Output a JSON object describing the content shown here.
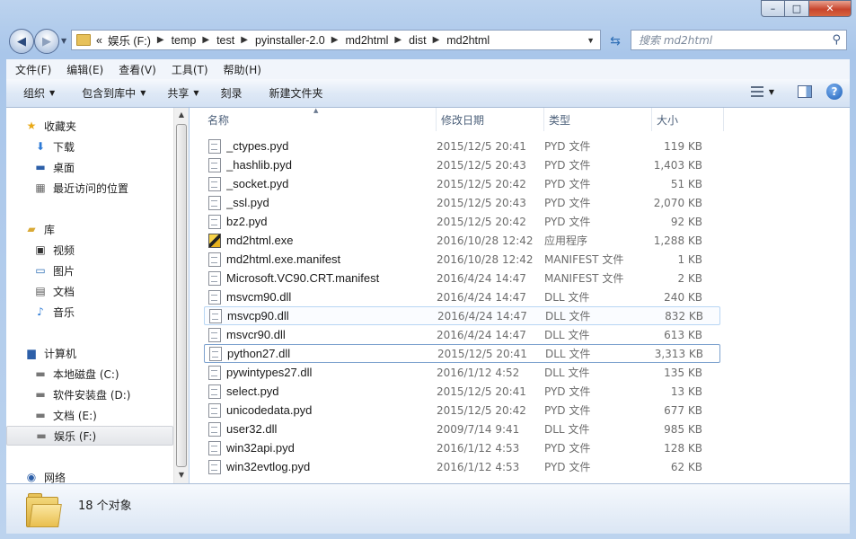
{
  "window": {
    "title": "md2html",
    "minimize": "–",
    "maximize": "□",
    "close": "✕"
  },
  "address": {
    "overflow": "«",
    "crumbs": [
      "娱乐 (F:)",
      "temp",
      "test",
      "pyinstaller-2.0",
      "md2html",
      "dist",
      "md2html"
    ],
    "search_placeholder": "搜索 md2html"
  },
  "menu": [
    "文件(F)",
    "编辑(E)",
    "查看(V)",
    "工具(T)",
    "帮助(H)"
  ],
  "toolbar": {
    "organize": "组织",
    "include_library": "包含到库中",
    "share": "共享",
    "burn": "刻录",
    "new_folder": "新建文件夹"
  },
  "nav": {
    "favorites": "收藏夹",
    "downloads": "下载",
    "desktop": "桌面",
    "recent": "最近访问的位置",
    "libraries": "库",
    "videos": "视频",
    "pictures": "图片",
    "documents": "文档",
    "music": "音乐",
    "computer": "计算机",
    "drive_c": "本地磁盘 (C:)",
    "drive_d": "软件安装盘 (D:)",
    "drive_e": "文档 (E:)",
    "drive_f": "娱乐 (F:)",
    "network": "网络"
  },
  "columns": {
    "name": "名称",
    "date": "修改日期",
    "type": "类型",
    "size": "大小"
  },
  "files": [
    {
      "name": "_ctypes.pyd",
      "date": "2015/12/5 20:41",
      "type": "PYD 文件",
      "size": "119 KB",
      "icon": "pyd-file-icon"
    },
    {
      "name": "_hashlib.pyd",
      "date": "2015/12/5 20:43",
      "type": "PYD 文件",
      "size": "1,403 KB",
      "icon": "pyd-file-icon"
    },
    {
      "name": "_socket.pyd",
      "date": "2015/12/5 20:42",
      "type": "PYD 文件",
      "size": "51 KB",
      "icon": "pyd-file-icon"
    },
    {
      "name": "_ssl.pyd",
      "date": "2015/12/5 20:43",
      "type": "PYD 文件",
      "size": "2,070 KB",
      "icon": "pyd-file-icon"
    },
    {
      "name": "bz2.pyd",
      "date": "2015/12/5 20:42",
      "type": "PYD 文件",
      "size": "92 KB",
      "icon": "pyd-file-icon"
    },
    {
      "name": "md2html.exe",
      "date": "2016/10/28 12:42",
      "type": "应用程序",
      "size": "1,288 KB",
      "icon": "exe-file-icon"
    },
    {
      "name": "md2html.exe.manifest",
      "date": "2016/10/28 12:42",
      "type": "MANIFEST 文件",
      "size": "1 KB",
      "icon": "manifest-file-icon"
    },
    {
      "name": "Microsoft.VC90.CRT.manifest",
      "date": "2016/4/24 14:47",
      "type": "MANIFEST 文件",
      "size": "2 KB",
      "icon": "manifest-file-icon"
    },
    {
      "name": "msvcm90.dll",
      "date": "2016/4/24 14:47",
      "type": "DLL 文件",
      "size": "240 KB",
      "icon": "dll-file-icon"
    },
    {
      "name": "msvcp90.dll",
      "date": "2016/4/24 14:47",
      "type": "DLL 文件",
      "size": "832 KB",
      "icon": "dll-file-icon"
    },
    {
      "name": "msvcr90.dll",
      "date": "2016/4/24 14:47",
      "type": "DLL 文件",
      "size": "613 KB",
      "icon": "dll-file-icon"
    },
    {
      "name": "python27.dll",
      "date": "2015/12/5 20:41",
      "type": "DLL 文件",
      "size": "3,313 KB",
      "icon": "dll-file-icon"
    },
    {
      "name": "pywintypes27.dll",
      "date": "2016/1/12 4:52",
      "type": "DLL 文件",
      "size": "135 KB",
      "icon": "dll-file-icon"
    },
    {
      "name": "select.pyd",
      "date": "2015/12/5 20:41",
      "type": "PYD 文件",
      "size": "13 KB",
      "icon": "pyd-file-icon"
    },
    {
      "name": "unicodedata.pyd",
      "date": "2015/12/5 20:42",
      "type": "PYD 文件",
      "size": "677 KB",
      "icon": "pyd-file-icon"
    },
    {
      "name": "user32.dll",
      "date": "2009/7/14 9:41",
      "type": "DLL 文件",
      "size": "985 KB",
      "icon": "dll-file-icon"
    },
    {
      "name": "win32api.pyd",
      "date": "2016/1/12 4:53",
      "type": "PYD 文件",
      "size": "128 KB",
      "icon": "pyd-file-icon"
    },
    {
      "name": "win32evtlog.pyd",
      "date": "2016/1/12 4:53",
      "type": "PYD 文件",
      "size": "62 KB",
      "icon": "pyd-file-icon"
    }
  ],
  "status": {
    "count": "18 个对象"
  }
}
